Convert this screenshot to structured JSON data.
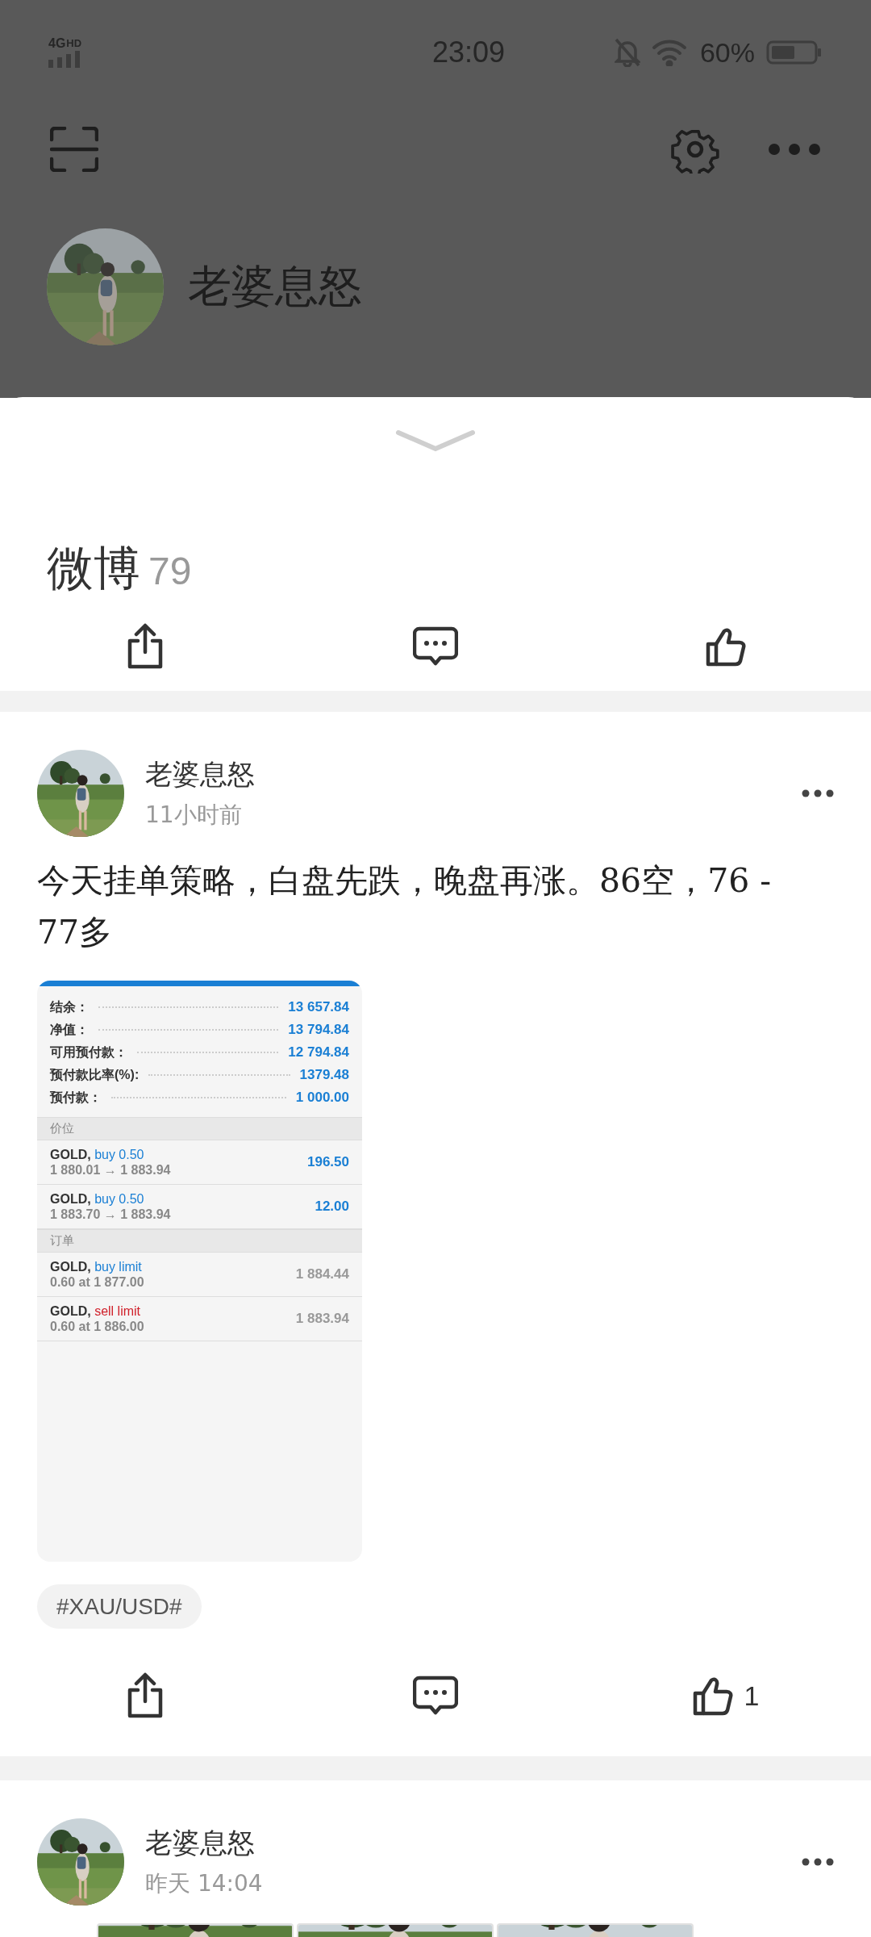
{
  "status_bar": {
    "network": "4G",
    "network_badge": "HD",
    "time": "23:09",
    "battery_text": "60%"
  },
  "profile": {
    "name": "老婆息怒"
  },
  "sheet": {
    "title": "微博",
    "count": "79",
    "actions": [
      {
        "kind": "share"
      },
      {
        "kind": "comment"
      },
      {
        "kind": "like"
      }
    ]
  },
  "posts": [
    {
      "author": "老婆息怒",
      "time": "11小时前",
      "text": "今天挂单策略，白盘先跌，晚盘再涨。86空，76 -77多",
      "screenshot": {
        "summary": [
          {
            "label": "结余：",
            "value": "13 657.84"
          },
          {
            "label": "净值：",
            "value": "13 794.84"
          },
          {
            "label": "可用预付款：",
            "value": "12 794.84"
          },
          {
            "label": "预付款比率(%):",
            "value": "1379.48"
          },
          {
            "label": "预付款：",
            "value": "1 000.00"
          }
        ],
        "sections": [
          {
            "title": "价位",
            "rows": [
              {
                "symbol": "GOLD,",
                "kind": "buy",
                "action": "buy 0.50",
                "detail": "1 880.01 → 1 883.94",
                "value": "196.50",
                "emphasis": true
              },
              {
                "symbol": "GOLD,",
                "kind": "buy",
                "action": "buy 0.50",
                "detail": "1 883.70 → 1 883.94",
                "value": "12.00",
                "emphasis": true
              }
            ]
          },
          {
            "title": "订单",
            "rows": [
              {
                "symbol": "GOLD,",
                "kind": "buy",
                "action": "buy limit",
                "detail": "0.60 at 1 877.00",
                "value": "1 884.44",
                "emphasis": false
              },
              {
                "symbol": "GOLD,",
                "kind": "sell",
                "action": "sell limit",
                "detail": "0.60 at 1 886.00",
                "value": "1 883.94",
                "emphasis": false
              }
            ]
          }
        ]
      },
      "tags": [
        "#XAU/USD#"
      ],
      "actions": [
        {
          "kind": "share"
        },
        {
          "kind": "comment"
        },
        {
          "kind": "like",
          "count": "1"
        }
      ]
    },
    {
      "author": "老婆息怒",
      "time": "昨天 14:04"
    }
  ]
}
